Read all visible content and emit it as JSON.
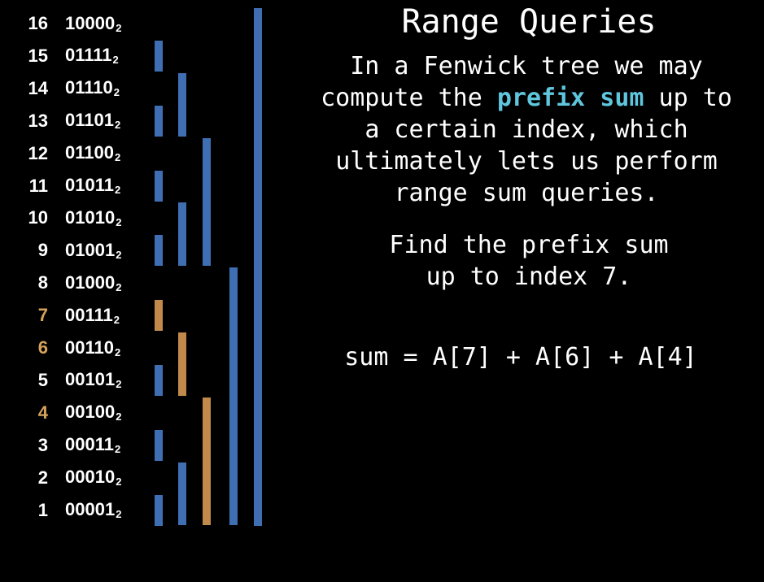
{
  "title": "Range Queries",
  "description": {
    "before": "In a Fenwick tree we may\ncompute the ",
    "keyword": "prefix sum",
    "after": " up to\na certain index, which\nultimately lets us perform\nrange sum queries."
  },
  "task": "Find the prefix sum\nup to index 7.",
  "formula": "sum = A[7] + A[6] + A[4]",
  "colors": {
    "bar": "#3f6fb2",
    "bar_highlight": "#c1894a",
    "index_highlight": "#d7a25a",
    "keyword": "#5fc6de",
    "background": "#000000"
  },
  "base_subscript": "2",
  "highlighted_indices": [
    7,
    6,
    4
  ],
  "rows": [
    {
      "index": "16",
      "binary": "10000"
    },
    {
      "index": "15",
      "binary": "01111"
    },
    {
      "index": "14",
      "binary": "01110"
    },
    {
      "index": "13",
      "binary": "01101"
    },
    {
      "index": "12",
      "binary": "01100"
    },
    {
      "index": "11",
      "binary": "01011"
    },
    {
      "index": "10",
      "binary": "01010"
    },
    {
      "index": "9",
      "binary": "01001"
    },
    {
      "index": "8",
      "binary": "01000"
    },
    {
      "index": "7",
      "binary": "00111"
    },
    {
      "index": "6",
      "binary": "00110"
    },
    {
      "index": "5",
      "binary": "00101"
    },
    {
      "index": "4",
      "binary": "00100"
    },
    {
      "index": "3",
      "binary": "00011"
    },
    {
      "index": "2",
      "binary": "00010"
    },
    {
      "index": "1",
      "binary": "00001"
    }
  ]
}
